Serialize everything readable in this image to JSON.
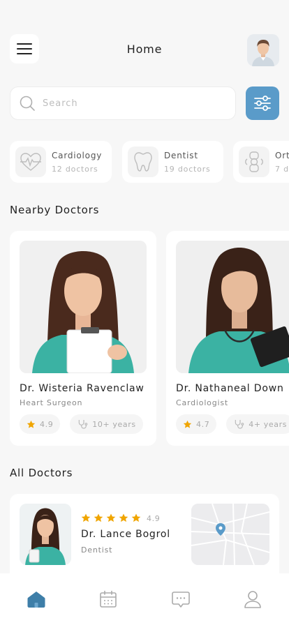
{
  "header": {
    "title": "Home",
    "menu_icon": "hamburger-menu-icon",
    "avatar": "user-avatar"
  },
  "search": {
    "placeholder": "Search",
    "value": ""
  },
  "filter_icon": "sliders-icon",
  "categories": [
    {
      "name": "Cardiology",
      "count": "12 doctors",
      "icon": "heart-pulse-icon"
    },
    {
      "name": "Dentist",
      "count": "19 doctors",
      "icon": "tooth-icon"
    },
    {
      "name": "Ort",
      "count": "7 d",
      "icon": "joint-icon"
    }
  ],
  "nearby": {
    "title": "Nearby Doctors",
    "doctors": [
      {
        "name": "Dr. Wisteria Ravenclaw",
        "specialty": "Heart Surgeon",
        "rating": "4.9",
        "experience": "10+ years"
      },
      {
        "name": "Dr. Nathaneal Down",
        "specialty": "Cardiologist",
        "rating": "4.7",
        "experience": "4+ years"
      }
    ]
  },
  "all_doctors": {
    "title": "All Doctors",
    "doctors": [
      {
        "name": "Dr. Lance Bogrol",
        "specialty": "Dentist",
        "rating": "4.9",
        "stars": 5
      }
    ]
  },
  "tabbar": {
    "items": [
      "home-icon",
      "calendar-icon",
      "chat-icon",
      "profile-icon"
    ],
    "active_color": "#3e7ea8"
  },
  "colors": {
    "accent": "#5a9bc9",
    "star": "#f0a500"
  }
}
